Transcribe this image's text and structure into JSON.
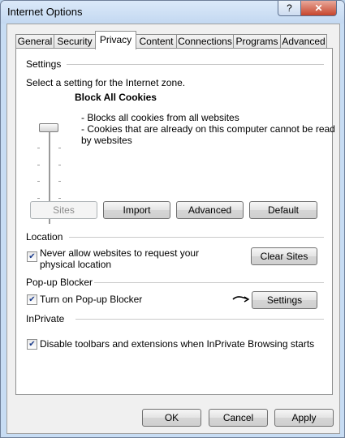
{
  "window": {
    "title": "Internet Options",
    "help_glyph": "?",
    "close_glyph": "✕"
  },
  "tabs": [
    {
      "label": "General"
    },
    {
      "label": "Security"
    },
    {
      "label": "Privacy"
    },
    {
      "label": "Content"
    },
    {
      "label": "Connections"
    },
    {
      "label": "Programs"
    },
    {
      "label": "Advanced"
    }
  ],
  "settings": {
    "group_label": "Settings",
    "zone_text": "Select a setting for the Internet zone.",
    "level_title": "Block All Cookies",
    "desc_line1": "- Blocks all cookies from all websites",
    "desc_line2": "- Cookies that are already on this computer cannot be read",
    "desc_line3": "by websites",
    "buttons": {
      "sites": "Sites",
      "import": "Import",
      "advanced": "Advanced",
      "default": "Default"
    }
  },
  "location": {
    "group_label": "Location",
    "checkbox_line1": "Never allow websites to request your",
    "checkbox_line2": "physical location",
    "checked": true,
    "clear_button": "Clear Sites"
  },
  "popup": {
    "group_label": "Pop-up Blocker",
    "checkbox_label": "Turn on Pop-up Blocker",
    "checked": true,
    "settings_button": "Settings"
  },
  "inprivate": {
    "group_label": "InPrivate",
    "checkbox_label": "Disable toolbars and extensions when InPrivate Browsing starts",
    "checked": true
  },
  "footer": {
    "ok": "OK",
    "cancel": "Cancel",
    "apply": "Apply"
  },
  "check_glyph": "✔"
}
